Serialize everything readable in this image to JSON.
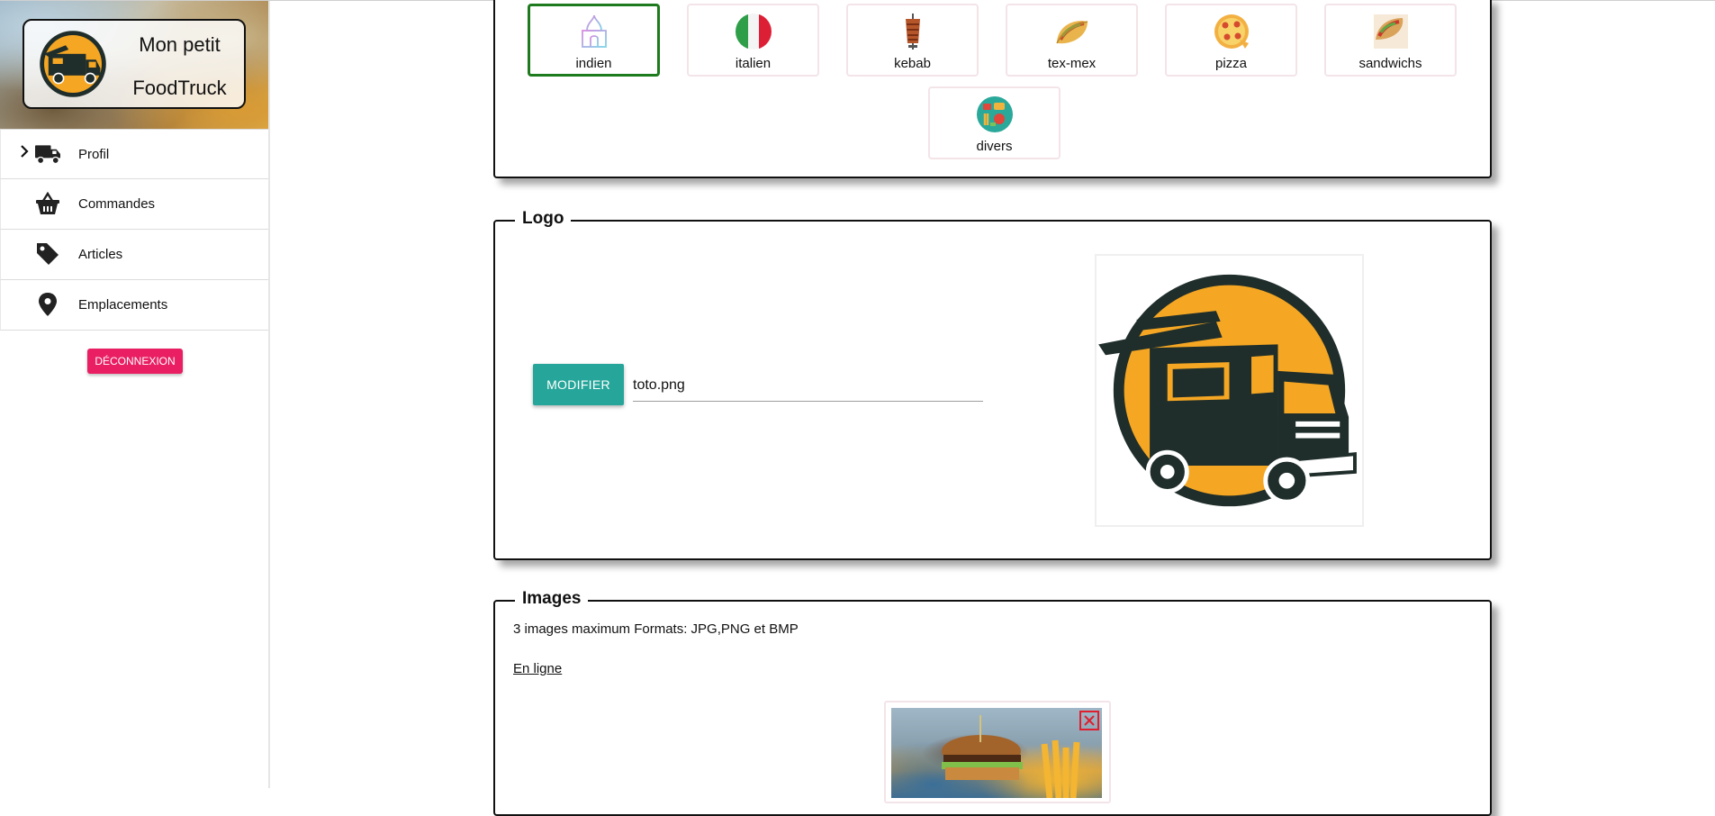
{
  "brand": {
    "line1": "Mon petit",
    "line2": "FoodTruck"
  },
  "nav": {
    "items": [
      {
        "label": "Profil",
        "icon": "truck-icon",
        "active": true
      },
      {
        "label": "Commandes",
        "icon": "basket-icon"
      },
      {
        "label": "Articles",
        "icon": "tag-icon"
      },
      {
        "label": "Emplacements",
        "icon": "map-pin-icon"
      }
    ],
    "logout_label": "DÉCONNEXION"
  },
  "categories": {
    "selected": "indien",
    "items": [
      {
        "label": "indien",
        "icon": "taj-mahal-icon"
      },
      {
        "label": "italien",
        "icon": "italy-flag-icon"
      },
      {
        "label": "kebab",
        "icon": "kebab-icon"
      },
      {
        "label": "tex-mex",
        "icon": "taco-icon"
      },
      {
        "label": "pizza",
        "icon": "pizza-icon"
      },
      {
        "label": "sandwichs",
        "icon": "sandwich-icon"
      },
      {
        "label": "divers",
        "icon": "mixed-food-icon"
      }
    ]
  },
  "logo_section": {
    "legend": "Logo",
    "modify_label": "MODIFIER",
    "file_name": "toto.png"
  },
  "images_section": {
    "legend": "Images",
    "hint": "3 images maximum Formats: JPG,PNG et BMP",
    "online_link": "En ligne"
  },
  "colors": {
    "accent_teal": "#26a69a",
    "logout_pink": "#e91e63",
    "selected_green": "#1d7a1d",
    "logo_orange": "#f5a623",
    "logo_dark": "#1f2e2b"
  }
}
